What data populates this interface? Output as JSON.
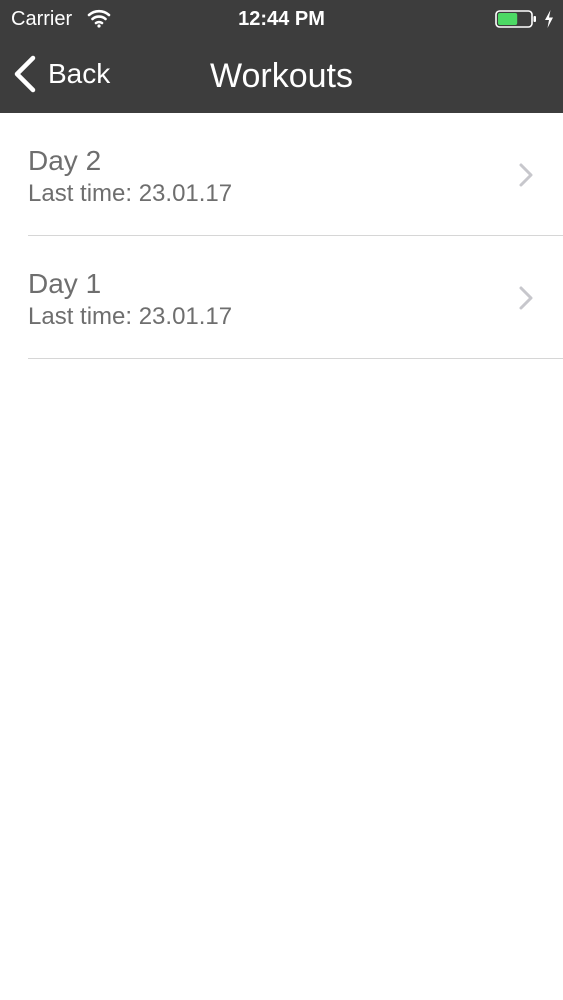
{
  "status_bar": {
    "carrier": "Carrier",
    "time": "12:44 PM",
    "wifi_icon": "wifi-icon",
    "battery_icon": "battery-icon",
    "charging_icon": "charging-bolt-icon",
    "battery_level": 0.6
  },
  "nav": {
    "back_label": "Back",
    "title": "Workouts",
    "back_icon": "chevron-left-icon"
  },
  "workouts": [
    {
      "title": "Day 2",
      "subtitle": "Last time: 23.01.17"
    },
    {
      "title": "Day 1",
      "subtitle": "Last time: 23.01.17"
    }
  ],
  "colors": {
    "header_background": "#3d3d3d",
    "header_text": "#ffffff",
    "list_text": "#6e6e6e",
    "separator": "#d6d6d6",
    "chevron": "#c7c7cc",
    "battery_fill": "#4cd964"
  }
}
